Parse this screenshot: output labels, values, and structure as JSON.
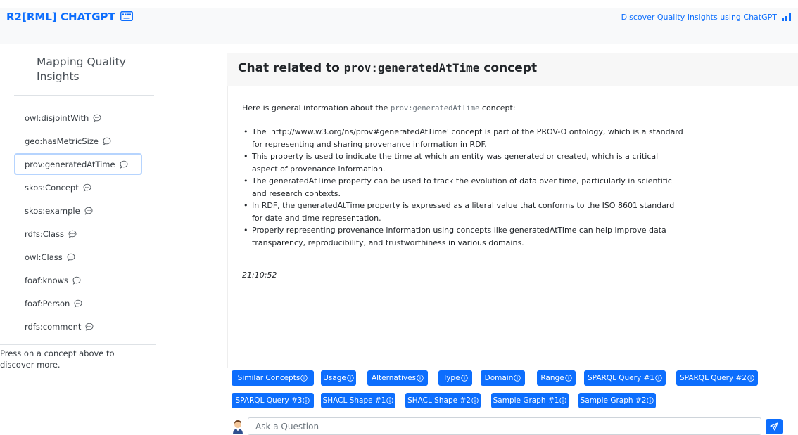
{
  "header": {
    "brand": "R2[RML] CHATGPT",
    "tagline": "Discover Quality Insights using ChatGPT"
  },
  "sidebar": {
    "title": "Mapping Quality Insights",
    "items": [
      {
        "label": "owl:disjointWith",
        "active": false
      },
      {
        "label": "geo:hasMetricSize",
        "active": false
      },
      {
        "label": "prov:generatedAtTime",
        "active": true
      },
      {
        "label": "skos:Concept",
        "active": false
      },
      {
        "label": "skos:example",
        "active": false
      },
      {
        "label": "rdfs:Class",
        "active": false
      },
      {
        "label": "owl:Class",
        "active": false
      },
      {
        "label": "foaf:knows",
        "active": false
      },
      {
        "label": "foaf:Person",
        "active": false
      },
      {
        "label": "rdfs:comment",
        "active": false
      }
    ],
    "help_text": "Press on a concept above to discover more."
  },
  "chat": {
    "title_prefix": "Chat related to",
    "title_concept": "prov:generatedAtTime",
    "title_suffix": "concept",
    "intro_prefix": "Here is general information about the",
    "intro_concept": "prov:generatedAtTime",
    "intro_suffix": "concept:",
    "bullets": [
      "The 'http://www.w3.org/ns/prov#generatedAtTime' concept is part of the PROV-O ontology, which is a standard for representing and sharing provenance information in RDF.",
      "This property is used to indicate the time at which an entity was generated or created, which is a critical aspect of provenance information.",
      "The generatedAtTime property can be used to track the evolution of data over time, particularly in scientific and research contexts.",
      "In RDF, the generatedAtTime property is expressed as a literal value that conforms to the ISO 8601 standard for date and time representation.",
      "Properly representing provenance information using concepts like generatedAtTime can help improve data transparency, reproducibility, and trustworthiness in various domains."
    ],
    "timestamp": "21:10:52"
  },
  "actions": {
    "row1": [
      "Similar Concepts",
      "Usage",
      "Alternatives",
      "Type",
      "Domain",
      "Range",
      "SPARQL Query #1",
      "SPARQL Query #2"
    ],
    "row2": [
      "SPARQL Query #3",
      "SHACL Shape #1",
      "SHACL Shape #2",
      "Sample Graph #1",
      "Sample Graph #2"
    ]
  },
  "composer": {
    "placeholder": "Ask a Question"
  },
  "colors": {
    "primary": "#0d6efd",
    "active_border": "#b6d4fe"
  }
}
